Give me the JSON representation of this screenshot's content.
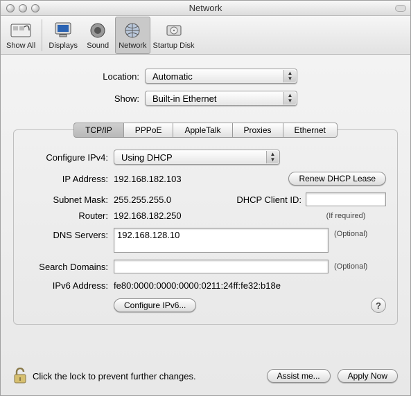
{
  "window": {
    "title": "Network"
  },
  "toolbar": {
    "showAll": "Show All",
    "displays": "Displays",
    "sound": "Sound",
    "network": "Network",
    "startupDisk": "Startup Disk"
  },
  "selects": {
    "locationLabel": "Location:",
    "locationValue": "Automatic",
    "showLabel": "Show:",
    "showValue": "Built-in Ethernet"
  },
  "tabs": {
    "tcpip": "TCP/IP",
    "pppoe": "PPPoE",
    "appletalk": "AppleTalk",
    "proxies": "Proxies",
    "ethernet": "Ethernet"
  },
  "tcpip": {
    "configureLabel": "Configure IPv4:",
    "configureValue": "Using DHCP",
    "ipLabel": "IP Address:",
    "ipValue": "192.168.182.103",
    "renewBtn": "Renew DHCP Lease",
    "subnetLabel": "Subnet Mask:",
    "subnetValue": "255.255.255.0",
    "dhcpClientLabel": "DHCP Client ID:",
    "dhcpClientValue": "",
    "dhcpClientNote": "(If required)",
    "routerLabel": "Router:",
    "routerValue": "192.168.182.250",
    "dnsLabel": "DNS Servers:",
    "dnsValue": "192.168.128.10",
    "dnsNote": "(Optional)",
    "searchDomainsLabel": "Search Domains:",
    "searchDomainsValue": "",
    "searchDomainsNote": "(Optional)",
    "ipv6Label": "IPv6 Address:",
    "ipv6Value": "fe80:0000:0000:0000:0211:24ff:fe32:b18e",
    "configureIpv6Btn": "Configure IPv6...",
    "helpChar": "?"
  },
  "footer": {
    "lockText": "Click the lock to prevent further changes.",
    "assistBtn": "Assist me...",
    "applyBtn": "Apply Now"
  }
}
